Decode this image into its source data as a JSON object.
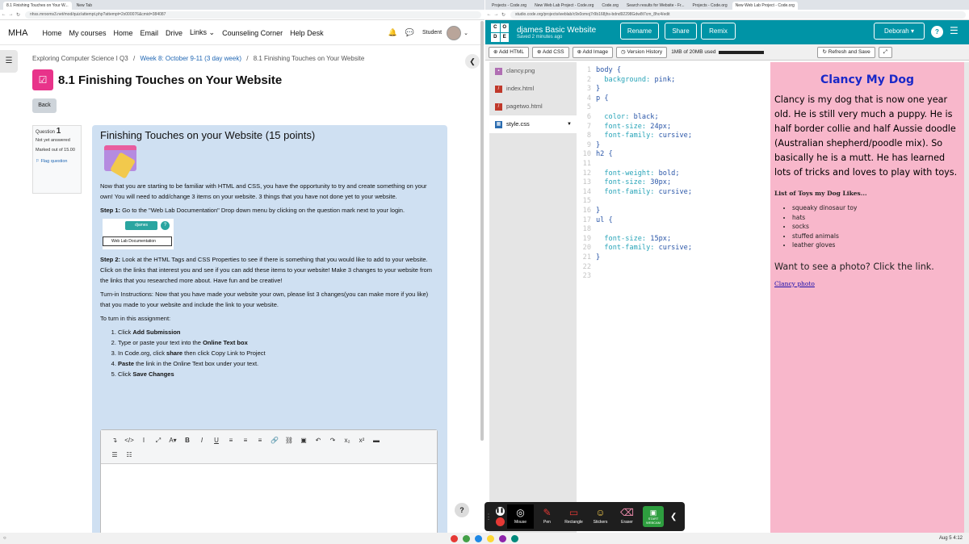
{
  "left": {
    "tabs": [
      "8.1 Finishing Touches on Your W...",
      "New Tab"
    ],
    "url": "nhss.mrooms3.net/mod/quiz/attempt.php?attempt=2x000076&cmid=384087",
    "brand": "MHA",
    "nav": [
      "Home",
      "My courses",
      "Home",
      "Email",
      "Drive",
      "Links",
      "Counseling Corner",
      "Help Desk"
    ],
    "user": "Student",
    "breadcrumb": {
      "course": "Exploring Computer Science I Q3",
      "sep": "/",
      "week": "Week 8: October 9-11 (3 day week)",
      "current": "8.1 Finishing Touches on Your Website"
    },
    "title": "8.1 Finishing Touches on Your Website",
    "back": "Back",
    "question": {
      "label": "Question",
      "number": "1",
      "status": "Not yet answered",
      "marked": "Marked out of 15.00",
      "flag": "Flag question"
    },
    "content": {
      "heading": "Finishing Touches on your Website (15 points)",
      "intro": "Now that you are starting to be familiar with HTML and CSS, you have the opportunity to try and create something on your own! You will need to add/change 3 items on your website. 3 things that you have not done yet to your website.",
      "step1_label": "Step 1:",
      "step1": " Go to the \"Web Lab Documentation\" Drop down menu by clicking on the question mark next to your login.",
      "mini_dropdown": "djames",
      "mini_menu": "Web Lab Documentation",
      "step2_label": "Step 2:",
      "step2": " Look at the HTML Tags and CSS Properties to see if there is something that you would like to add to your website. Click on the links that interest you and see if you can add these items to your website! Make 3 changes to your website from the links that you researched more about. Have fun and be creative!",
      "turnin": "Turn-in Instructions: Now that you have made your website your own, please list 3 changes(you can make more if you like) that you made to your website and include the link to your website.",
      "toturn": "To turn in this assignment:",
      "steps": [
        {
          "a": "Click ",
          "b": "Add Submission",
          "c": ""
        },
        {
          "a": "Type or paste your text into the ",
          "b": "Online Text box",
          "c": ""
        },
        {
          "a": "In Code.org, click ",
          "b": "share",
          "c": " then click Copy Link to Project"
        },
        {
          "a": "",
          "b": "Paste",
          "c": " the link in the Online Text box under your text."
        },
        {
          "a": "Click ",
          "b": "Save Changes",
          "c": ""
        }
      ]
    }
  },
  "right": {
    "tabs": [
      "Projects - Code.org",
      "New Web Lab Project - Code.org",
      "Code.org",
      "Search results for Website - Fr...",
      "Projects - Code.org",
      "New Web Lab Project - Code.org"
    ],
    "url": "studio.code.org/projects/weblab/c9x0omoj7r9b168jhs-bdnd92298Gdw8t7cm_8hc4/edit",
    "project_name": "djames Basic Website",
    "saved": "Saved 2 minutes ago",
    "buttons": {
      "rename": "Rename",
      "share": "Share",
      "remix": "Remix",
      "user": "Deborah"
    },
    "toolbar": {
      "add_html": "Add HTML",
      "add_css": "Add CSS",
      "add_image": "Add Image",
      "version": "Version History",
      "storage": "1MB of 20MB used",
      "refresh": "Refresh and Save"
    },
    "files": [
      "clancy.png",
      "index.html",
      "pagetwo.html",
      "style.css"
    ],
    "code": [
      "body {",
      "  background: pink;",
      "}",
      "p {",
      "",
      "  color: black;",
      "  font-size: 24px;",
      "  font-family: cursive;",
      "}",
      "h2 {",
      "",
      "  font-weight: bold;",
      "  font-size: 30px;",
      "  font-family: cursive;",
      "",
      "}",
      "ul {",
      "",
      "  font-size: 15px;",
      "  font-family: cursive;",
      "}",
      "",
      ""
    ],
    "preview": {
      "title": "Clancy My Dog",
      "para": "Clancy is my dog that is now one year old. He is still very much a puppy. He is half border collie and half Aussie doodle (Australian shepherd/poodle mix). So basically he is a mutt. He has learned lots of tricks and loves to play with toys.",
      "list_title": "List of Toys my Dog Likes...",
      "toys": [
        "squeaky dinosaur toy",
        "hats",
        "socks",
        "stuffed animals",
        "leather gloves"
      ],
      "question": "Want to see a photo? Click the link.",
      "link": "Clancy photo"
    }
  },
  "recorder": {
    "tools": [
      "Mouse",
      "Pen",
      "Rectangle",
      "Stickers",
      "Eraser",
      "START WEBCAM"
    ]
  },
  "taskbar": {
    "time": "4:12",
    "date": "Aug 5"
  }
}
